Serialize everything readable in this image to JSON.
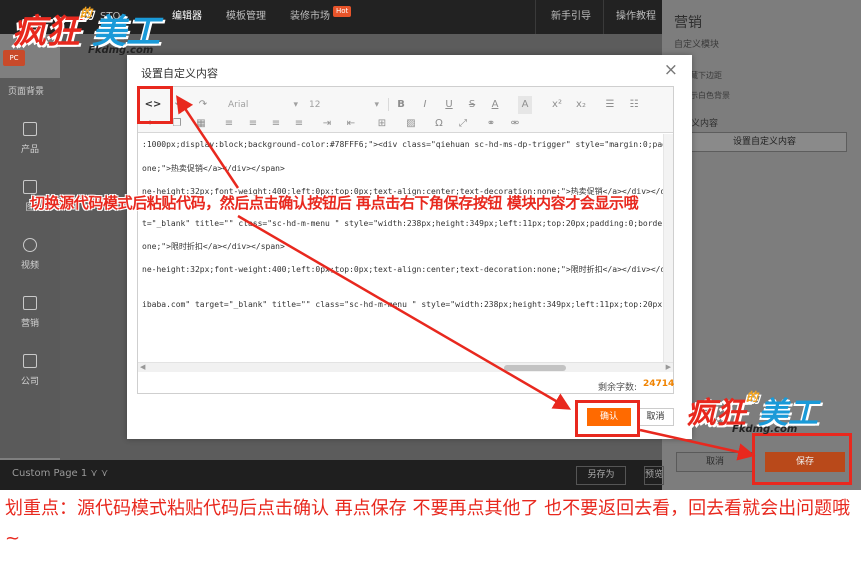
{
  "app": {
    "top_nav": [
      {
        "label": "STO"
      },
      {
        "label": "编辑器",
        "active": true
      },
      {
        "label": "模板管理"
      },
      {
        "label": "装修市场",
        "badge": "Hot"
      },
      {
        "label": "新手引导"
      },
      {
        "label": "操作教程"
      }
    ],
    "sidebar_header": "页面背景",
    "sidebar_tab_label": "PC",
    "sidebar_items": [
      {
        "label": "产品",
        "icon": "product-icon"
      },
      {
        "label": "图",
        "icon": "image-icon"
      },
      {
        "label": "视频",
        "icon": "video-icon"
      },
      {
        "label": "营销",
        "icon": "marketing-icon"
      },
      {
        "label": "公司",
        "icon": "company-icon"
      }
    ],
    "bottom_bar": {
      "page_label": "Custom Page 1 ⋎ ⋎",
      "save_as": "另存为",
      "preview": "预览"
    }
  },
  "right_panel": {
    "title": "营销",
    "subtitle": "自定义模块",
    "option_1": "隐藏下边距",
    "option_2": "显示白色背景",
    "section_label": "定义内容",
    "set_content_button": "设置自定义内容",
    "cancel_button": "取消",
    "save_button": "保存"
  },
  "dialog": {
    "title": "设置自定义内容",
    "close_symbol": "×",
    "toolbar": {
      "source_code": "<>",
      "undo": "↶",
      "redo": "↷",
      "font_family": "Arial",
      "font_size": "12",
      "bold": "B",
      "italic": "I",
      "underline": "U",
      "strikethrough": "S",
      "font_color": "A",
      "bg_color": "A",
      "superscript": "x²",
      "subscript": "x₂",
      "bullet_list": "☰",
      "number_list": "☷",
      "cut": "✂",
      "copy": "❐",
      "paste": "▦",
      "align_left": "≡",
      "align_center": "≡",
      "align_right": "≡",
      "justify": "≡",
      "indent": "⇥",
      "outdent": "⇤",
      "table": "⊞",
      "image": "▨",
      "omega": "Ω",
      "fullscreen": "⤢",
      "link": "⚭",
      "unlink": "⚮"
    },
    "code_lines": [
      ":1000px;display:block;background-color:#78FFF6;\"><div class=\"qiehuan sc-hd-ms-dp-trigger\" style=\"margin:0;padd",
      "one;\">热卖促销</a></div></span>",
      "ne-height:32px;font-weight:400;left:0px;top:0px;text-align:center;text-decoration:none;\">热卖促销</a></div></div",
      "t=\"_blank\" title=\"\" class=\"sc-hd-m-menu \" style=\"width:238px;height:349px;left:11px;top:20px;padding:0;border:",
      "one;\">限时折扣</a></div></span>",
      "ne-height:32px;font-weight:400;left:0px;top:0px;text-align:center;text-decoration:none;\">限时折扣</a></div></div",
      "ibaba.com\" target=\"_blank\" title=\"\" class=\"sc-hd-m-menu \" style=\"width:238px;height:349px;left:11px;top:20px;pa"
    ],
    "remaining_chars_label": "剩余字数:",
    "remaining_chars_value": "24714",
    "confirm_button": "确认",
    "cancel_button": "取消"
  },
  "annotation": {
    "banner": "切换源代码模式后粘贴代码，然后点击确认按钮后 再点击右下角保存按钮 模块内容才会显示哦",
    "caption": "划重点：源代码模式粘贴代码后点击确认 再点保存 不要再点其他了 也不要返回去看，回去看就会出问题哦~",
    "accent_color": "#e8281e"
  },
  "watermark": {
    "main_a": "疯狂",
    "small": "的",
    "main_b": "美工",
    "url": "Fkdmg.com"
  }
}
